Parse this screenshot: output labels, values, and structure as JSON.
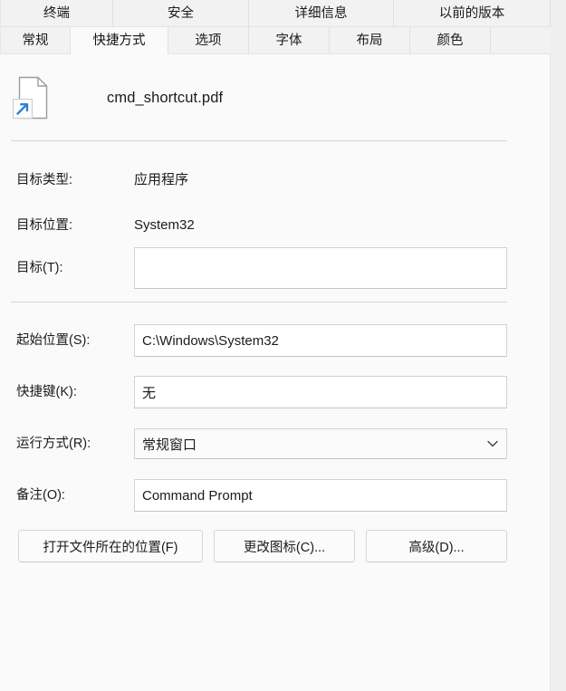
{
  "tabs": {
    "row1": [
      {
        "label": "终端",
        "active": false
      },
      {
        "label": "安全",
        "active": false
      },
      {
        "label": "详细信息",
        "active": false
      },
      {
        "label": "以前的版本",
        "active": false
      }
    ],
    "row2": [
      {
        "label": "常规",
        "active": false
      },
      {
        "label": "快捷方式",
        "active": true
      },
      {
        "label": "选项",
        "active": false
      },
      {
        "label": "字体",
        "active": false
      },
      {
        "label": "布局",
        "active": false
      },
      {
        "label": "颜色",
        "active": false
      }
    ]
  },
  "header": {
    "icon": "shortcut-document-icon",
    "filename": "cmd_shortcut.pdf"
  },
  "info": {
    "target_type_label": "目标类型:",
    "target_type_value": "应用程序",
    "target_location_label": "目标位置:",
    "target_location_value": "System32"
  },
  "fields": {
    "target": {
      "label": "目标(T):",
      "value": "",
      "placeholder": ""
    },
    "start_in": {
      "label": "起始位置(S):",
      "value": "C:\\Windows\\System32",
      "placeholder": ""
    },
    "hotkey": {
      "label": "快捷键(K):",
      "value": "无",
      "placeholder": ""
    },
    "run": {
      "label": "运行方式(R):",
      "value": "常规窗口",
      "arrow_icon": "chevron-down-icon"
    },
    "comment": {
      "label": "备注(O):",
      "value": "Command Prompt",
      "placeholder": ""
    }
  },
  "buttons": {
    "open_file_location": "打开文件所在的位置(F)",
    "change_icon": "更改图标(C)...",
    "advanced": "高级(D)..."
  },
  "colors": {
    "accent_blue": "#2f7fd1",
    "panel_bg": "#fafafa",
    "tab_bg": "#f2f2f2",
    "window_bg": "#efefef",
    "text": "#1b1b1b",
    "separator": "#d6d6d6"
  }
}
